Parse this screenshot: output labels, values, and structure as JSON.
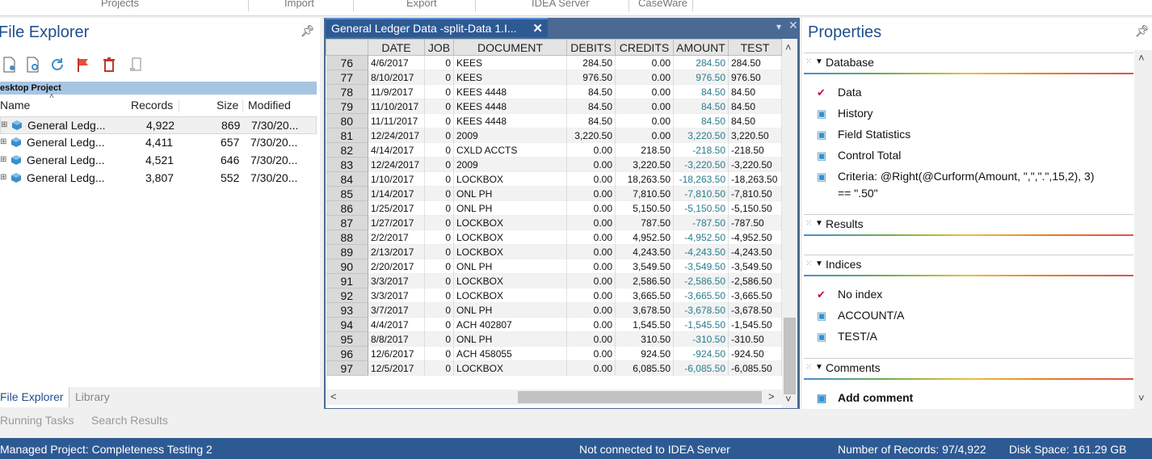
{
  "ribbon": {
    "groups": [
      "Projects",
      "Import",
      "Export",
      "IDEA Server",
      "CaseWare"
    ]
  },
  "file_explorer": {
    "title": "File Explorer",
    "project_bar": "esktop Project",
    "columns": {
      "name": "Name",
      "records": "Records",
      "size": "Size",
      "modified": "Modified"
    },
    "files": [
      {
        "name": "General Ledg...",
        "records": "4,922",
        "size": "869",
        "modified": "7/30/20..."
      },
      {
        "name": "General Ledg...",
        "records": "4,411",
        "size": "657",
        "modified": "7/30/20..."
      },
      {
        "name": "General Ledg...",
        "records": "4,521",
        "size": "646",
        "modified": "7/30/20..."
      },
      {
        "name": "General Ledg...",
        "records": "3,807",
        "size": "552",
        "modified": "7/30/20..."
      }
    ],
    "tabs": {
      "explorer": "File Explorer",
      "library": "Library"
    },
    "bottom_tabs": {
      "running": "Running Tasks",
      "search": "Search Results"
    }
  },
  "grid": {
    "tab_title": "General Ledger Data -split-Data 1.I...",
    "tab_close": "✕",
    "headers": [
      "DATE",
      "JOB",
      "DOCUMENT",
      "DEBITS",
      "CREDITS",
      "AMOUNT",
      "TEST"
    ],
    "rows": [
      [
        "76",
        "4/6/2017",
        "0",
        "KEES",
        "284.50",
        "0.00",
        "284.50",
        "284.50"
      ],
      [
        "77",
        "8/10/2017",
        "0",
        "KEES",
        "976.50",
        "0.00",
        "976.50",
        "976.50"
      ],
      [
        "78",
        "11/9/2017",
        "0",
        "KEES 4448",
        "84.50",
        "0.00",
        "84.50",
        "84.50"
      ],
      [
        "79",
        "11/10/2017",
        "0",
        "KEES 4448",
        "84.50",
        "0.00",
        "84.50",
        "84.50"
      ],
      [
        "80",
        "11/11/2017",
        "0",
        "KEES 4448",
        "84.50",
        "0.00",
        "84.50",
        "84.50"
      ],
      [
        "81",
        "12/24/2017",
        "0",
        "2009",
        "3,220.50",
        "0.00",
        "3,220.50",
        "3,220.50"
      ],
      [
        "82",
        "4/14/2017",
        "0",
        "CXLD ACCTS",
        "0.00",
        "218.50",
        "-218.50",
        "-218.50"
      ],
      [
        "83",
        "12/24/2017",
        "0",
        "2009",
        "0.00",
        "3,220.50",
        "-3,220.50",
        "-3,220.50"
      ],
      [
        "84",
        "1/10/2017",
        "0",
        "LOCKBOX",
        "0.00",
        "18,263.50",
        "-18,263.50",
        "-18,263.50"
      ],
      [
        "85",
        "1/14/2017",
        "0",
        "ONL PH",
        "0.00",
        "7,810.50",
        "-7,810.50",
        "-7,810.50"
      ],
      [
        "86",
        "1/25/2017",
        "0",
        "ONL PH",
        "0.00",
        "5,150.50",
        "-5,150.50",
        "-5,150.50"
      ],
      [
        "87",
        "1/27/2017",
        "0",
        "LOCKBOX",
        "0.00",
        "787.50",
        "-787.50",
        "-787.50"
      ],
      [
        "88",
        "2/2/2017",
        "0",
        "LOCKBOX",
        "0.00",
        "4,952.50",
        "-4,952.50",
        "-4,952.50"
      ],
      [
        "89",
        "2/13/2017",
        "0",
        "LOCKBOX",
        "0.00",
        "4,243.50",
        "-4,243.50",
        "-4,243.50"
      ],
      [
        "90",
        "2/20/2017",
        "0",
        "ONL PH",
        "0.00",
        "3,549.50",
        "-3,549.50",
        "-3,549.50"
      ],
      [
        "91",
        "3/3/2017",
        "0",
        "LOCKBOX",
        "0.00",
        "2,586.50",
        "-2,586.50",
        "-2,586.50"
      ],
      [
        "92",
        "3/3/2017",
        "0",
        "LOCKBOX",
        "0.00",
        "3,665.50",
        "-3,665.50",
        "-3,665.50"
      ],
      [
        "93",
        "3/7/2017",
        "0",
        "ONL PH",
        "0.00",
        "3,678.50",
        "-3,678.50",
        "-3,678.50"
      ],
      [
        "94",
        "4/4/2017",
        "0",
        "ACH 402807",
        "0.00",
        "1,545.50",
        "-1,545.50",
        "-1,545.50"
      ],
      [
        "95",
        "8/8/2017",
        "0",
        "ONL PH",
        "0.00",
        "310.50",
        "-310.50",
        "-310.50"
      ],
      [
        "96",
        "12/6/2017",
        "0",
        "ACH 458055",
        "0.00",
        "924.50",
        "-924.50",
        "-924.50"
      ],
      [
        "97",
        "12/5/2017",
        "0",
        "LOCKBOX",
        "0.00",
        "6,085.50",
        "-6,085.50",
        "-6,085.50"
      ]
    ]
  },
  "properties": {
    "title": "Properties",
    "database": {
      "label": "Database",
      "items": [
        "Data",
        "History",
        "Field Statistics",
        "Control Total"
      ],
      "criteria_line1": "Criteria: @Right(@Curform(Amount, \",\",\".\",15,2), 3)",
      "criteria_line2": "== \".50\""
    },
    "results": {
      "label": "Results"
    },
    "indices": {
      "label": "Indices",
      "items": [
        "No index",
        "ACCOUNT/A",
        "TEST/A"
      ]
    },
    "comments": {
      "label": "Comments",
      "add": "Add comment"
    }
  },
  "status": {
    "project": "Managed Project: Completeness Testing 2",
    "server": "Not connected to IDEA Server",
    "records": "Number of Records: 97/4,922",
    "disk": "Disk Space: 161.29 GB"
  },
  "colors": {
    "accent": "#2e5a94",
    "title_blue": "#1f4e8c",
    "amount_teal": "#2a7d8d",
    "check_red": "#c0143c"
  }
}
